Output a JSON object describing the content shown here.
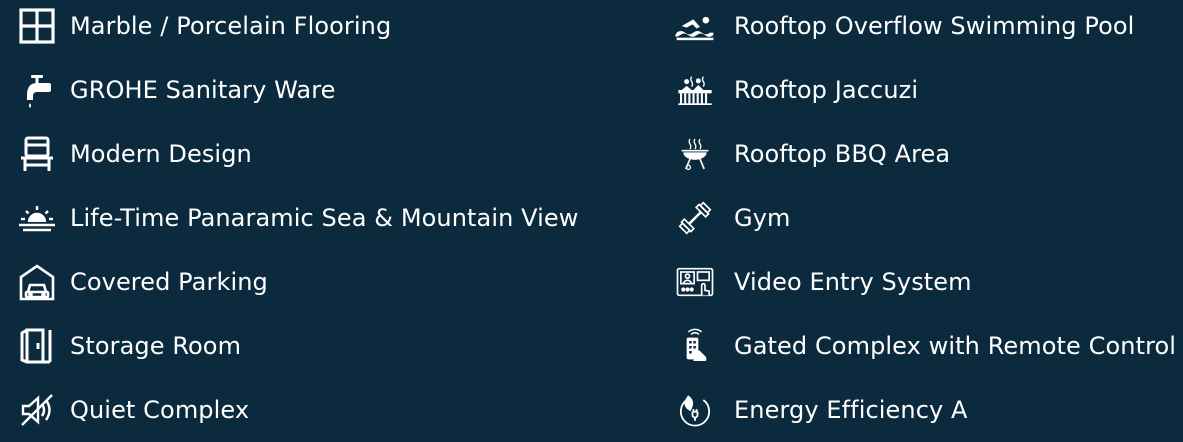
{
  "colors": {
    "background": "#0c2a3e",
    "text": "#ffffff"
  },
  "features": {
    "left": [
      {
        "label": "Marble / Porcelain Flooring",
        "icon": "floor-tiles-icon"
      },
      {
        "label": "GROHE Sanitary Ware",
        "icon": "faucet-icon"
      },
      {
        "label": "Modern Design",
        "icon": "chair-icon"
      },
      {
        "label": "Life-Time Panaramic Sea & Mountain View",
        "icon": "sunrise-icon"
      },
      {
        "label": "Covered Parking",
        "icon": "garage-car-icon"
      },
      {
        "label": "Storage Room",
        "icon": "door-icon"
      },
      {
        "label": "Quiet Complex",
        "icon": "mute-icon"
      }
    ],
    "right": [
      {
        "label": "Rooftop Overflow Swimming Pool",
        "icon": "swimmer-icon"
      },
      {
        "label": "Rooftop Jaccuzi",
        "icon": "hot-tub-icon"
      },
      {
        "label": "Rooftop BBQ Area",
        "icon": "bbq-grill-icon"
      },
      {
        "label": "Gym",
        "icon": "dumbbell-icon"
      },
      {
        "label": "Video Entry System",
        "icon": "video-intercom-icon"
      },
      {
        "label": "Gated Complex with Remote Control",
        "icon": "remote-control-icon"
      },
      {
        "label": "Energy Efficiency A",
        "icon": "eco-plug-icon"
      }
    ]
  }
}
